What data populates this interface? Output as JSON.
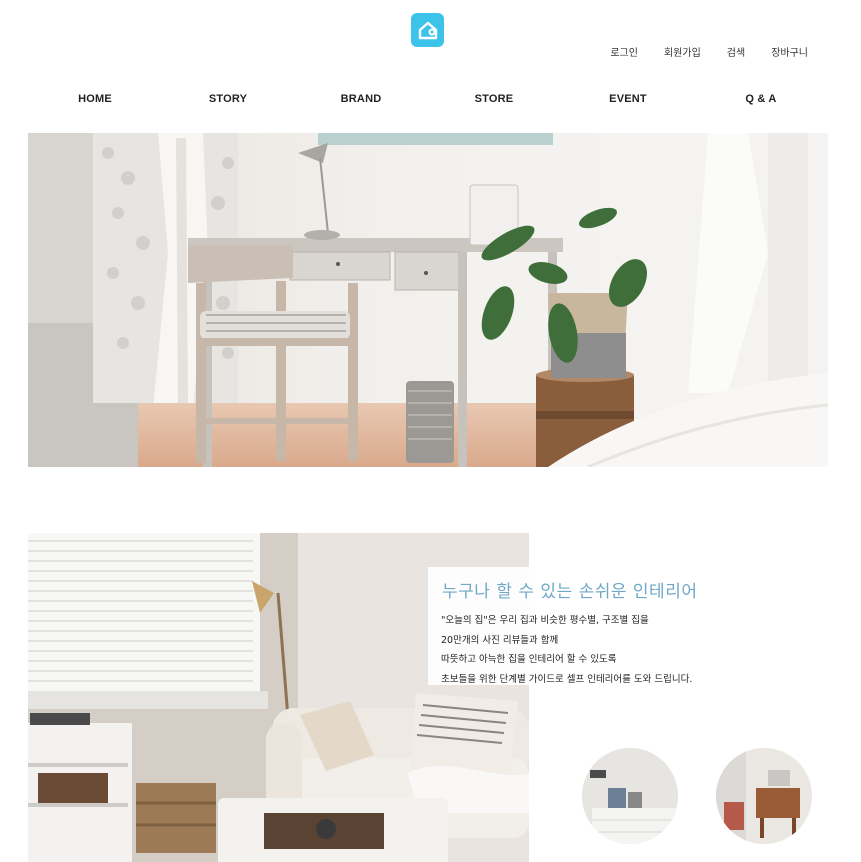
{
  "header": {
    "logo_icon": "house-icon",
    "brand_color": "#3cc3ea",
    "util_links": [
      "로그인",
      "회원가입",
      "검색",
      "장바구니"
    ]
  },
  "nav": {
    "items": [
      "HOME",
      "STORY",
      "BRAND",
      "STORE",
      "EVENT",
      "Q & A"
    ]
  },
  "intro": {
    "title": "누구나 할 수 있는 손쉬운 인테리어",
    "lines": [
      "\"오늘의 집\"은 우리 집과 비슷한 평수별, 구조별 집을",
      "20만개의 사진 리뷰들과 함께",
      "따뜻하고 아늑한 집을 인테리어 할 수 있도록",
      "초보들을 위한 단계별 가이드로 셀프 인테리어를 도와 드립니다."
    ],
    "title_color": "#6fa8c7"
  }
}
